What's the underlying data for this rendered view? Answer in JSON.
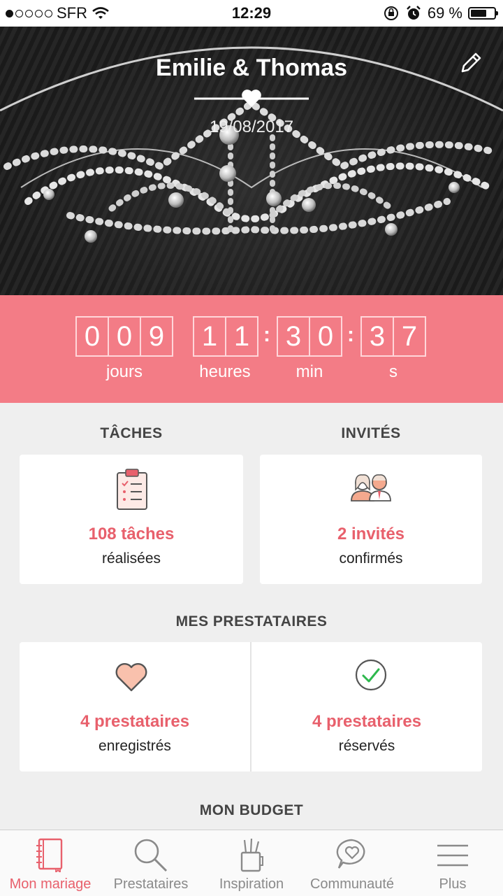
{
  "status_bar": {
    "carrier": "SFR",
    "time": "12:29",
    "battery": "69 %",
    "battery_level": 0.69
  },
  "header": {
    "couple": "Emilie & Thomas",
    "date": "19/08/2017"
  },
  "countdown": {
    "days": [
      "0",
      "0",
      "9"
    ],
    "hours": [
      "1",
      "1"
    ],
    "minutes": [
      "3",
      "0"
    ],
    "seconds": [
      "3",
      "7"
    ],
    "labels": {
      "days": "jours",
      "hours": "heures",
      "minutes": "min",
      "seconds": "s"
    }
  },
  "tasks": {
    "title": "TÂCHES",
    "count": "108 tâches",
    "caption": "réalisées"
  },
  "guests": {
    "title": "INVITÉS",
    "count": "2 invités",
    "caption": "confirmés"
  },
  "vendors": {
    "title": "MES PRESTATAIRES",
    "saved": {
      "count": "4 prestataires",
      "caption": "enregistrés"
    },
    "booked": {
      "count": "4 prestataires",
      "caption": "réservés"
    }
  },
  "budget": {
    "title": "MON BUDGET"
  },
  "tabs": [
    {
      "label": "Mon mariage",
      "icon": "notebook-icon",
      "active": true
    },
    {
      "label": "Prestataires",
      "icon": "search-icon",
      "active": false
    },
    {
      "label": "Inspiration",
      "icon": "pencil-cup-icon",
      "active": false
    },
    {
      "label": "Communauté",
      "icon": "chat-heart-icon",
      "active": false
    },
    {
      "label": "Plus",
      "icon": "menu-icon",
      "active": false
    }
  ],
  "colors": {
    "accent": "#f37c86",
    "accent_text": "#e8606c",
    "background": "#efefef"
  }
}
